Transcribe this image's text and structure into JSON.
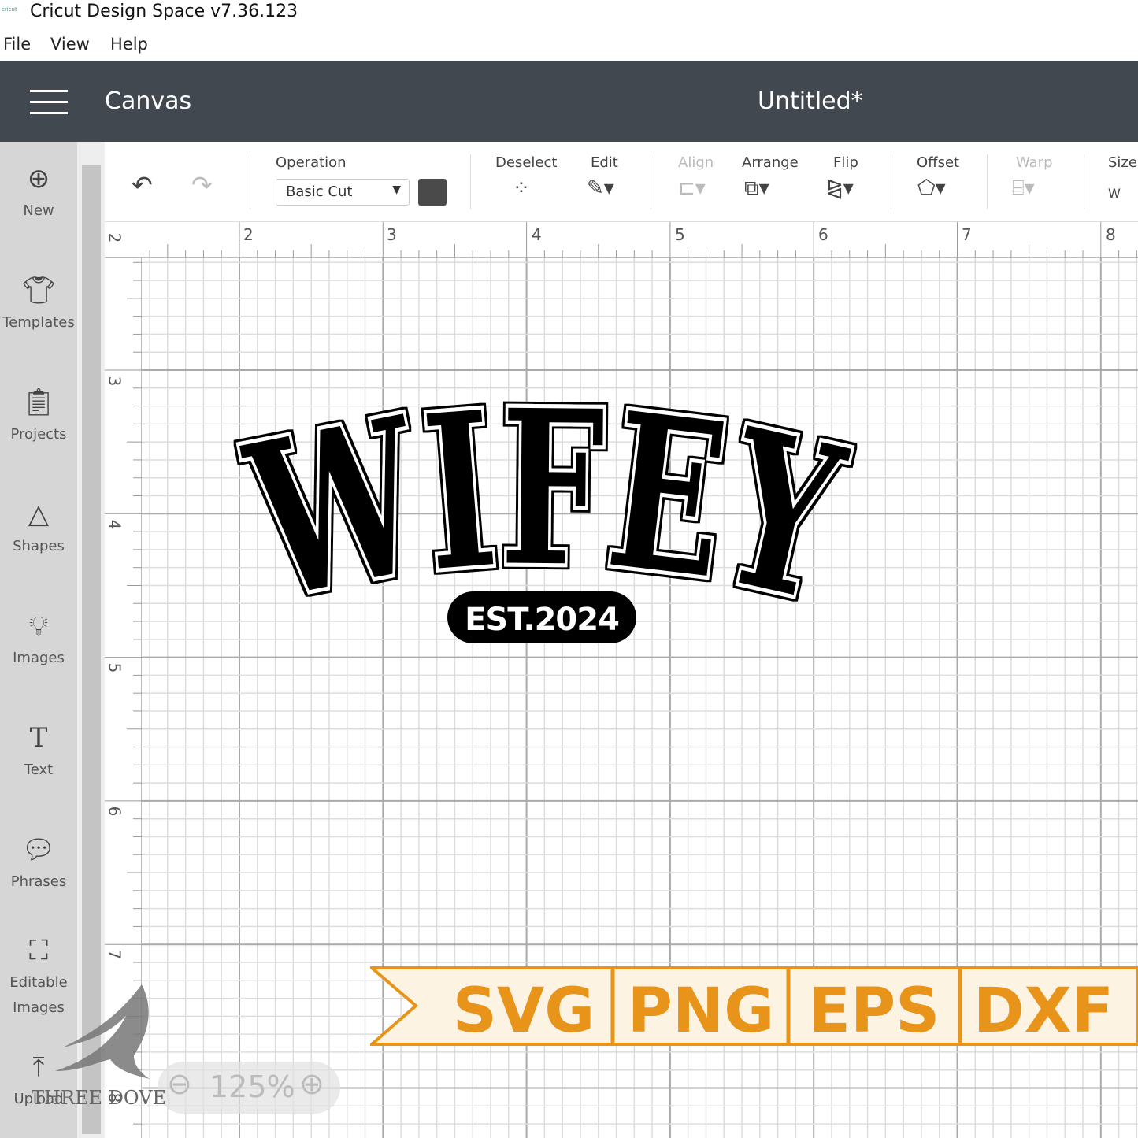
{
  "window": {
    "app_logo": "cricut",
    "title": "Cricut Design Space  v7.36.123"
  },
  "menu": [
    "File",
    "View",
    "Help"
  ],
  "header": {
    "section": "Canvas",
    "document": "Untitled*"
  },
  "sidebar": [
    {
      "label": "New",
      "icon": "plus-circle-icon"
    },
    {
      "label": "Templates",
      "icon": "tshirt-icon"
    },
    {
      "label": "Projects",
      "icon": "clipboard-icon"
    },
    {
      "label": "Shapes",
      "icon": "shapes-icon"
    },
    {
      "label": "Images",
      "icon": "lightbulb-icon"
    },
    {
      "label": "Text",
      "icon": "text-icon"
    },
    {
      "label": "Phrases",
      "icon": "speech-bubble-icon"
    },
    {
      "label": "Editable",
      "label2": "Images",
      "icon": "editable-images-icon"
    },
    {
      "label": "Upload",
      "icon": "upload-icon"
    }
  ],
  "toolbar": {
    "operation_label": "Operation",
    "operation_value": "Basic Cut",
    "operation_color": "#4a4a4a",
    "deselect": "Deselect",
    "edit": "Edit",
    "align": "Align",
    "arrange": "Arrange",
    "flip": "Flip",
    "offset": "Offset",
    "warp": "Warp",
    "size": "Size",
    "size_w": "W"
  },
  "ruler": {
    "top": [
      "2",
      "3",
      "4",
      "5",
      "6",
      "7",
      "8"
    ],
    "left": [
      "2",
      "3",
      "4",
      "5",
      "6",
      "7",
      "8"
    ]
  },
  "design": {
    "main_text": "WIFEY",
    "sub_text": "EST.2024"
  },
  "banner": {
    "formats": [
      "SVG",
      "PNG",
      "EPS",
      "DXF"
    ],
    "accent": "#e8941a",
    "fill": "#fdf3e3"
  },
  "zoom": {
    "level": "125%"
  },
  "watermark": "THREE DOVE"
}
